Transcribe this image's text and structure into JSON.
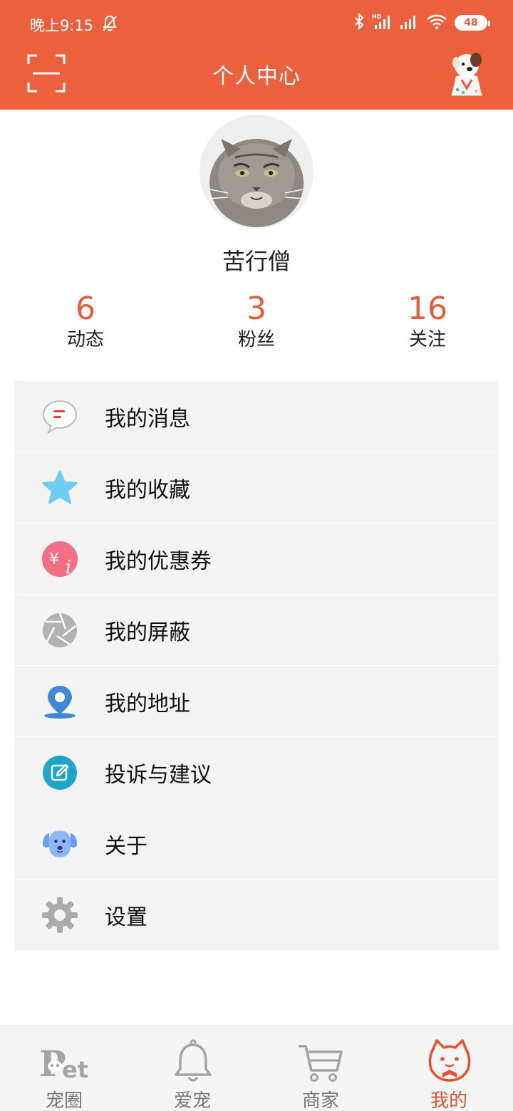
{
  "status_bar": {
    "time": "晚上9:15",
    "battery": "48"
  },
  "header": {
    "title": "个人中心"
  },
  "profile": {
    "username": "苦行僧"
  },
  "stats": [
    {
      "value": "6",
      "label": "动态"
    },
    {
      "value": "3",
      "label": "粉丝"
    },
    {
      "value": "16",
      "label": "关注"
    }
  ],
  "menu": [
    {
      "label": "我的消息",
      "icon": "message-icon"
    },
    {
      "label": "我的收藏",
      "icon": "star-icon"
    },
    {
      "label": "我的优惠券",
      "icon": "coupon-icon"
    },
    {
      "label": "我的屏蔽",
      "icon": "shutter-icon"
    },
    {
      "label": "我的地址",
      "icon": "location-icon"
    },
    {
      "label": "投诉与建议",
      "icon": "edit-icon"
    },
    {
      "label": "关于",
      "icon": "dog-face-icon"
    },
    {
      "label": "设置",
      "icon": "gear-icon"
    }
  ],
  "bottom_nav": [
    {
      "label": "宠圈",
      "icon": "pet-logo-icon"
    },
    {
      "label": "爱宠",
      "icon": "bell-icon"
    },
    {
      "label": "商家",
      "icon": "cart-icon"
    },
    {
      "label": "我的",
      "icon": "cat-face-icon",
      "active": true
    }
  ],
  "colors": {
    "accent": "#ec613d",
    "stat_number": "#e65b3a",
    "menu_bg": "#f4f4f4",
    "nav_active": "#e8502f",
    "nav_inactive": "#777777"
  }
}
